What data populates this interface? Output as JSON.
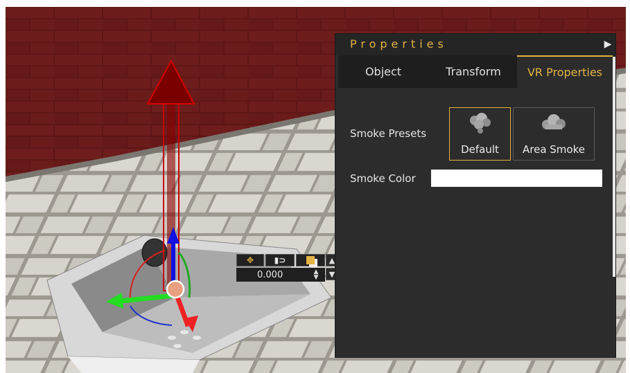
{
  "panel": {
    "title": "Properties",
    "collapse_glyph": "▶",
    "tabs": [
      {
        "label": "Object",
        "active": false
      },
      {
        "label": "Transform",
        "active": false
      },
      {
        "label": "VR Properties",
        "active": true
      }
    ],
    "smoke_presets_label": "Smoke Presets",
    "presets": [
      {
        "label": "Default",
        "icon": "smoke-cloud-icon",
        "selected": true
      },
      {
        "label": "Area Smoke",
        "icon": "smoke-cloud-icon",
        "selected": false
      }
    ],
    "smoke_color_label": "Smoke Color",
    "smoke_color_value": "#ffffff"
  },
  "gizmo_toolbar": {
    "value": "0.000",
    "buttons": [
      "move-icon",
      "snap-icon",
      "local-global-icon"
    ],
    "arrows": [
      "▲",
      "▼"
    ],
    "spinner_up": "▲",
    "spinner_down": "▼"
  },
  "colors": {
    "accent": "#e3b443",
    "panel_bg": "#2c2c2c",
    "tab_bar_bg": "#1e1e1e",
    "brick": "#6b1a1a",
    "floor": "#b9b5ae"
  }
}
